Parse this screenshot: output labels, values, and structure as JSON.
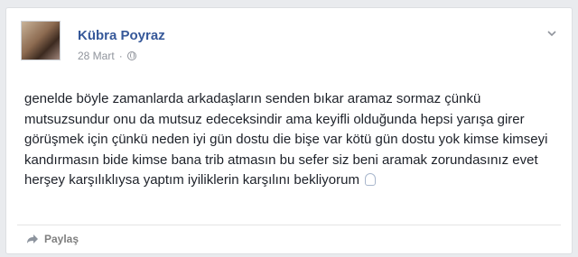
{
  "post": {
    "author": "Kübra Poyraz",
    "date": "28 Mart",
    "separator": "·",
    "privacy_icon": "globe-icon",
    "menu_icon": "chevron-down-icon",
    "text": "genelde böyle zamanlarda arkadaşların senden bıkar aramaz sormaz çünkü mutsuzsundur onu da mutsuz edeceksindir ama keyifli olduğunda hepsi yarışa girer görüşmek için çünkü neden iyi gün dostu die bişe var kötü gün dostu yok kimse kimseyi kandırmasın bide kimse bana trib atmasın bu sefer siz beni aramak zorundasınız evet herşey karşılıklıysa yaptım iyiliklerin karşılını bekliyorum",
    "emoticon_icon": "emoticon-icon"
  },
  "actions": {
    "share_label": "Paylaş",
    "share_icon": "share-arrow-icon"
  }
}
